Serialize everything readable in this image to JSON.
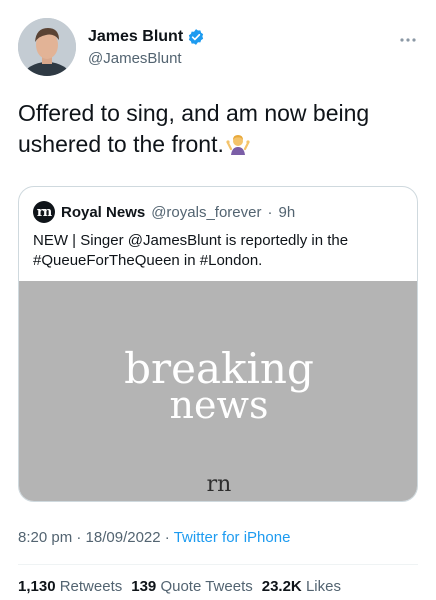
{
  "author": {
    "display_name": "James Blunt",
    "handle": "@JamesBlunt",
    "verified": true,
    "avatar_icon": "profile-photo"
  },
  "tweet": {
    "text": "Offered to sing, and am now being ushered to the front.",
    "emoji": "person-shrugging-emoji"
  },
  "quote": {
    "avatar_text": "rn",
    "name": "Royal News",
    "handle": "@royals_forever",
    "separator": "·",
    "time": "9h",
    "text": "NEW | Singer @JamesBlunt is reportedly in the #QueueForTheQueen in #London.",
    "media": {
      "line1": "breaking",
      "line2": "news",
      "logo": "rn",
      "background": "#b4b4b4"
    }
  },
  "meta": {
    "time": "8:20 pm",
    "dot1": "·",
    "date": "18/09/2022",
    "dot2": "·",
    "source": "Twitter for iPhone"
  },
  "stats": {
    "retweets_count": "1,130",
    "retweets_label": "Retweets",
    "quotes_count": "139",
    "quotes_label": "Quote Tweets",
    "likes_count": "23.2K",
    "likes_label": "Likes"
  },
  "colors": {
    "accent": "#1d9bf0",
    "secondary_text": "#536471",
    "primary_text": "#0f1419"
  }
}
